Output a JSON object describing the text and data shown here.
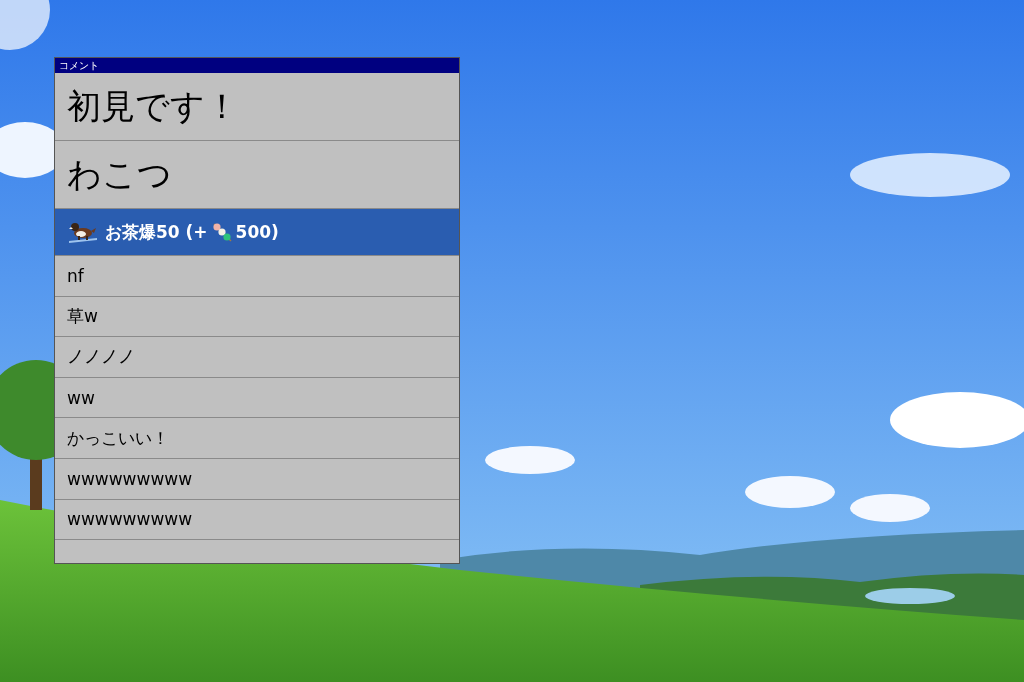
{
  "window": {
    "title": "コメント"
  },
  "comments": [
    {
      "kind": "large",
      "text": "初見です！"
    },
    {
      "kind": "large",
      "text": "わこつ"
    },
    {
      "kind": "gift",
      "text": "お茶爆50 (+",
      "amount": "500)"
    },
    {
      "kind": "normal",
      "text": "nf"
    },
    {
      "kind": "normal",
      "text": "草w"
    },
    {
      "kind": "normal",
      "text": "ノノノノ"
    },
    {
      "kind": "normal",
      "text": "ww"
    },
    {
      "kind": "normal",
      "text": "かっこいい！"
    },
    {
      "kind": "normal",
      "text": "wwwwwwwww"
    },
    {
      "kind": "normal",
      "text": "wwwwwwwww"
    }
  ]
}
